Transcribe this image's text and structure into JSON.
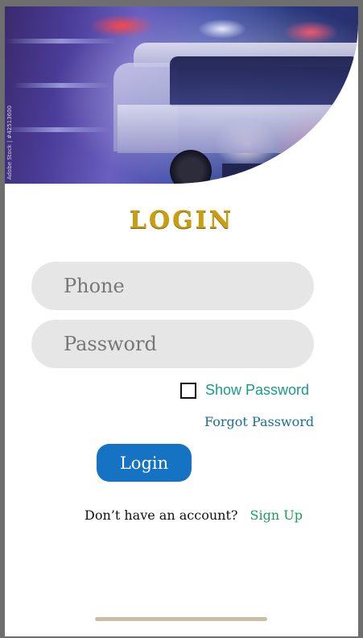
{
  "hero": {
    "image_description_icon": "ambulance-photo",
    "watermark": "Adobe Stock | #42513600"
  },
  "title": "LOGIN",
  "phone": {
    "placeholder": "Phone",
    "value": ""
  },
  "password": {
    "placeholder": "Password",
    "value": ""
  },
  "show_password": {
    "label": "Show Password",
    "checked": false
  },
  "forgot_password": "Forgot Password",
  "login_button": "Login",
  "signup": {
    "prompt": "Don’t have an account?",
    "link": "Sign Up"
  },
  "colors": {
    "title_gold": "#c99d14",
    "field_bg": "#e6e6e6",
    "show_password_teal": "#1a9a8a",
    "forgot_blue": "#1a6f94",
    "login_button_blue": "#1672c2",
    "signup_green": "#1c9a5f"
  }
}
